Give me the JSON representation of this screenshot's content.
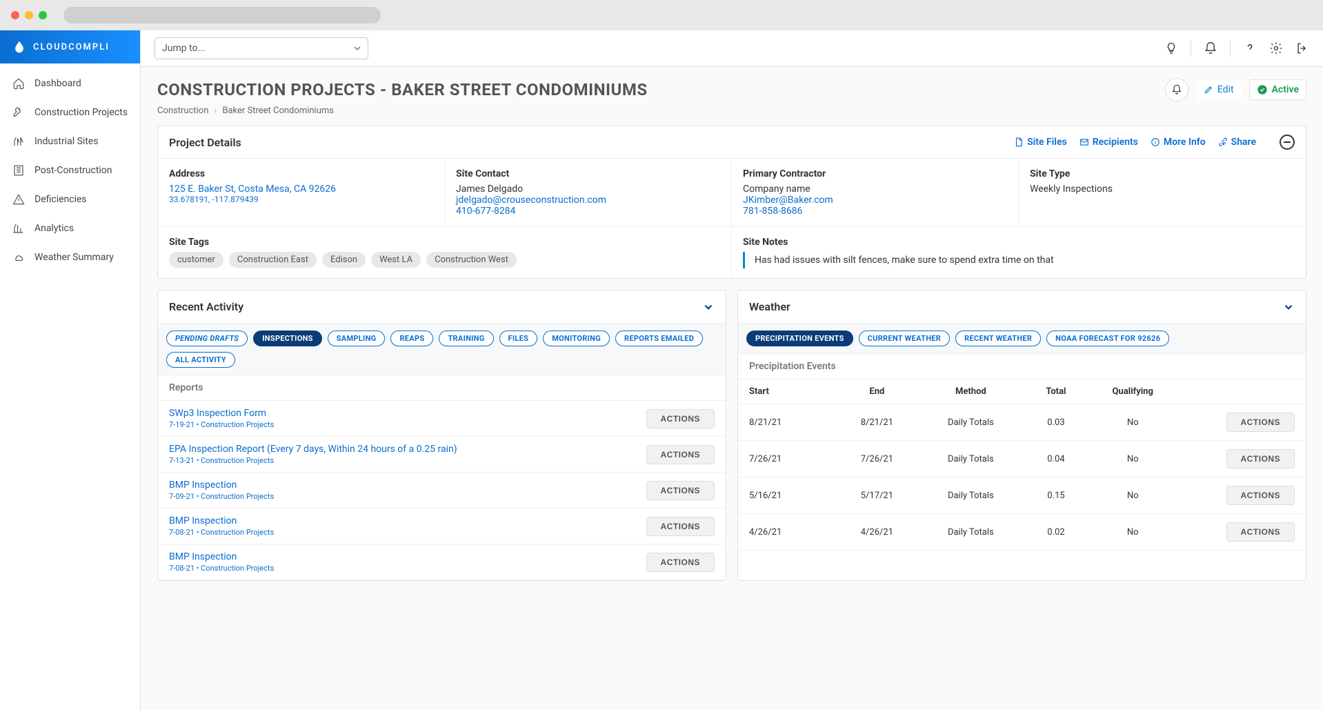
{
  "brand": "CLOUDCOMPLI",
  "jump_to": {
    "placeholder": "Jump to..."
  },
  "sidebar": {
    "items": [
      {
        "label": "Dashboard"
      },
      {
        "label": "Construction Projects"
      },
      {
        "label": "Industrial Sites"
      },
      {
        "label": "Post-Construction"
      },
      {
        "label": "Deficiencies"
      },
      {
        "label": "Analytics"
      },
      {
        "label": "Weather Summary"
      }
    ]
  },
  "page_title": "CONSTRUCTION PROJECTS - BAKER STREET CONDOMINIUMS",
  "header_actions": {
    "edit": "Edit",
    "active": "Active"
  },
  "breadcrumb": {
    "a": "Construction",
    "b": "Baker Street Condominiums"
  },
  "details_card": {
    "title": "Project Details",
    "links": {
      "site_files": "Site Files",
      "recipients": "Recipients",
      "more_info": "More Info",
      "share": "Share"
    },
    "address": {
      "label": "Address",
      "line1": "125 E. Baker St, Costa Mesa, CA 92626",
      "coords": "33.678191, -117.879439"
    },
    "contact": {
      "label": "Site Contact",
      "name": "James Delgado",
      "email": "jdelgado@crouseconstruction.com",
      "phone": "410-677-8284"
    },
    "contractor": {
      "label": "Primary Contractor",
      "company": "Company name",
      "email": "JKimber@Baker.com",
      "phone": "781-858-8686"
    },
    "site_type": {
      "label": "Site Type",
      "value": "Weekly Inspections"
    },
    "tags": {
      "label": "Site Tags",
      "items": [
        "customer",
        "Construction East",
        "Edison",
        "West LA",
        "Construction West"
      ]
    },
    "notes": {
      "label": "Site Notes",
      "text": "Has had issues with silt fences, make sure to spend extra time on that"
    }
  },
  "recent": {
    "title": "Recent Activity",
    "tabs": [
      "PENDING DRAFTS",
      "INSPECTIONS",
      "SAMPLING",
      "REAPS",
      "TRAINING",
      "FILES",
      "MONITORING",
      "REPORTS EMAILED",
      "ALL ACTIVITY"
    ],
    "active_tab": "INSPECTIONS",
    "reports_label": "Reports",
    "actions_label": "ACTIONS",
    "reports": [
      {
        "title": "SWp3 Inspection Form",
        "meta": "7-19-21 • Construction Projects"
      },
      {
        "title": "EPA Inspection Report (Every 7 days, Within 24 hours of a 0.25 rain)",
        "meta": "7-13-21 • Construction Projects"
      },
      {
        "title": "BMP Inspection",
        "meta": "7-09-21 • Construction Projects"
      },
      {
        "title": "BMP Inspection",
        "meta": "7-08-21 • Construction Projects"
      },
      {
        "title": "BMP Inspection",
        "meta": "7-08-21 • Construction Projects"
      }
    ]
  },
  "weather": {
    "title": "Weather",
    "tabs": [
      "PRECIPITATION EVENTS",
      "CURRENT WEATHER",
      "RECENT WEATHER",
      "NOAA FORECAST FOR 92626"
    ],
    "active_tab": "PRECIPITATION EVENTS",
    "subhead": "Precipitation Events",
    "columns": {
      "start": "Start",
      "end": "End",
      "method": "Method",
      "total": "Total",
      "qualifying": "Qualifying"
    },
    "actions_label": "ACTIONS",
    "rows": [
      {
        "start": "8/21/21",
        "end": "8/21/21",
        "method": "Daily Totals",
        "total": "0.03",
        "qualifying": "No"
      },
      {
        "start": "7/26/21",
        "end": "7/26/21",
        "method": "Daily Totals",
        "total": "0.04",
        "qualifying": "No"
      },
      {
        "start": "5/16/21",
        "end": "5/17/21",
        "method": "Daily Totals",
        "total": "0.15",
        "qualifying": "No"
      },
      {
        "start": "4/26/21",
        "end": "4/26/21",
        "method": "Daily Totals",
        "total": "0.02",
        "qualifying": "No"
      }
    ]
  }
}
